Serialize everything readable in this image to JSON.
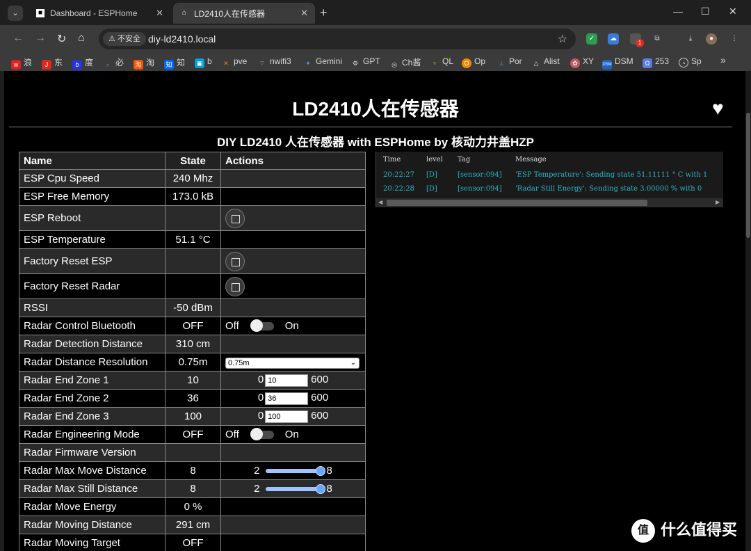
{
  "browser": {
    "tabs": [
      {
        "title": "Dashboard - ESPHome",
        "active": false
      },
      {
        "title": "LD2410人在传感器",
        "active": true
      }
    ],
    "security_chip": "不安全",
    "url": "diy-ld2410.local",
    "bookmarks": [
      "浪",
      "东",
      "度",
      "必",
      "淘",
      "知",
      "b",
      "pve",
      "nwifi3",
      "Gemini",
      "GPT",
      "Ch酱",
      "QL",
      "Op",
      "Por",
      "Alist",
      "XY",
      "DSM",
      "253",
      "Sp"
    ],
    "extension_badge": "1"
  },
  "page": {
    "title": "LD2410人在传感器",
    "subtitle": "DIY LD2410 人在传感器 with ESPHome by 核动力井盖HZP"
  },
  "table": {
    "headers": {
      "name": "Name",
      "state": "State",
      "actions": "Actions"
    },
    "rows": [
      {
        "name": "ESP Cpu Speed",
        "state": "240 Mhz"
      },
      {
        "name": "ESP Free Memory",
        "state": "173.0 kB"
      },
      {
        "name": "ESP Reboot",
        "state": ""
      },
      {
        "name": "ESP Temperature",
        "state": "51.1 °C"
      },
      {
        "name": "Factory Reset ESP",
        "state": ""
      },
      {
        "name": "Factory Reset Radar",
        "state": ""
      },
      {
        "name": "RSSI",
        "state": "-50 dBm"
      },
      {
        "name": "Radar Control Bluetooth",
        "state": "OFF",
        "off": "Off",
        "on": "On"
      },
      {
        "name": "Radar Detection Distance",
        "state": "310 cm"
      },
      {
        "name": "Radar Distance Resolution",
        "state": "0.75m",
        "select": "0.75m"
      },
      {
        "name": "Radar End Zone 1",
        "state": "10",
        "min": "0",
        "value": "10",
        "max": "600"
      },
      {
        "name": "Radar End Zone 2",
        "state": "36",
        "min": "0",
        "value": "36",
        "max": "600"
      },
      {
        "name": "Radar End Zone 3",
        "state": "100",
        "min": "0",
        "value": "100",
        "max": "600"
      },
      {
        "name": "Radar Engineering Mode",
        "state": "OFF",
        "off": "Off",
        "on": "On"
      },
      {
        "name": "Radar Firmware Version",
        "state": ""
      },
      {
        "name": "Radar Max Move Distance",
        "state": "8",
        "min": "2",
        "max": "8"
      },
      {
        "name": "Radar Max Still Distance",
        "state": "8",
        "min": "2",
        "max": "8"
      },
      {
        "name": "Radar Move Energy",
        "state": "0 %"
      },
      {
        "name": "Radar Moving Distance",
        "state": "291 cm"
      },
      {
        "name": "Radar Moving Target",
        "state": "OFF"
      }
    ]
  },
  "log": {
    "headers": {
      "time": "Time",
      "level": "level",
      "tag": "Tag",
      "message": "Message"
    },
    "entries": [
      {
        "time": "20:22:27",
        "level": "[D]",
        "tag": "[sensor:094]",
        "message": "'ESP Temperature': Sending state 51.11111 ° C with 1"
      },
      {
        "time": "20:22:28",
        "level": "[D]",
        "tag": "[sensor:094]",
        "message": "'Radar Still Energy': Sending state 3.00000 % with 0"
      }
    ]
  },
  "watermark": "什么值得买",
  "colors": {
    "log_text": "#29b6c6",
    "slider": "#6aa6ff",
    "page_bg": "#000000"
  }
}
